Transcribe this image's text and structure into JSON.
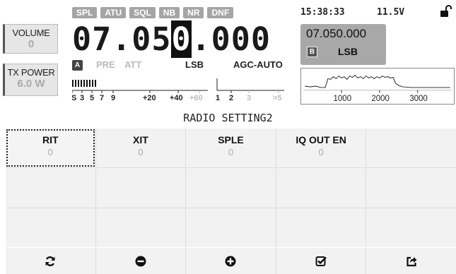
{
  "volume": {
    "label": "VOLUME",
    "value": "0"
  },
  "tx_power": {
    "label": "TX POWER",
    "value": "6.0 W"
  },
  "flags": [
    "SPL",
    "ATU",
    "SQL",
    "NB",
    "NR",
    "DNF"
  ],
  "vfo_a": {
    "tag": "A",
    "freq_pre": "07.05",
    "freq_cursor": "0",
    "freq_post": ".000",
    "pre": "PRE",
    "att": "ATT",
    "mode": "LSB",
    "agc": "AGC-AUTO"
  },
  "clock": "15:38:33",
  "voltage": "11.5V",
  "vfo_b": {
    "tag": "B",
    "freq": "07.050.000",
    "mode": "LSB"
  },
  "smeter": {
    "s_ticks": [
      "S",
      "3",
      "5",
      "7",
      "9"
    ],
    "plus_ticks": [
      "+20",
      "+40",
      "+60"
    ],
    "swr_ticks": [
      "1",
      "2",
      "3",
      ">5"
    ]
  },
  "spectrum": {
    "ticks": [
      "1000",
      "2000",
      "3000"
    ]
  },
  "title": "RADIO SETTING2",
  "settings": [
    {
      "name": "RIT",
      "value": "0"
    },
    {
      "name": "XIT",
      "value": "0"
    },
    {
      "name": "SPLE",
      "value": "0"
    },
    {
      "name": "IQ OUT EN",
      "value": "0"
    }
  ],
  "toolbar": {
    "refresh": "refresh-icon",
    "minus": "minus-circle-icon",
    "plus": "plus-circle-icon",
    "confirm": "check-square-icon",
    "exit": "share-exit-icon"
  },
  "colors": {
    "flag_bg": "#a5a5a5",
    "vfo_b_bg": "#a8a8a8",
    "cell_bg": "#f2f2f2"
  }
}
